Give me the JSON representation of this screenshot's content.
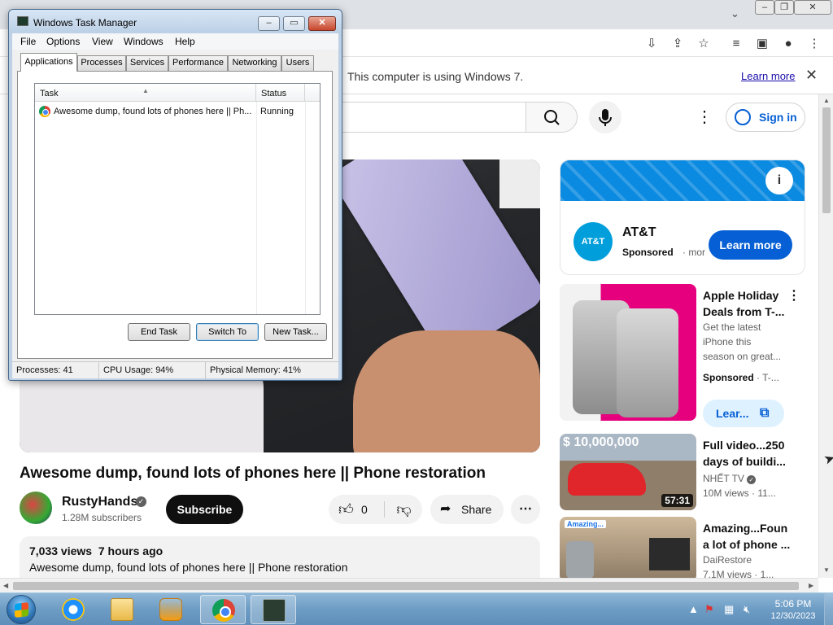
{
  "browser": {
    "infobar_text": "This computer is using Windows 7.",
    "infobar_link": "Learn more"
  },
  "youtube": {
    "signin_label": "Sign in",
    "video": {
      "title": "Awesome dump, found lots of phones here || Phone restoration",
      "channel": "RustyHands",
      "subscribers": "1.28M subscribers",
      "subscribe_label": "Subscribe",
      "like_count": "0",
      "share_label": "Share",
      "views": "7,033 views",
      "uploaded": "7 hours ago",
      "description": "Awesome dump, found lots of phones here || Phone restoration"
    },
    "ad": {
      "logo_text": "AT&T",
      "advertiser": "AT&T",
      "sponsored": "Sponsored",
      "more": "· mor",
      "cta": "Learn more"
    },
    "recommendations": [
      {
        "title_line1": "Apple Holiday",
        "title_line2": "Deals from T-...",
        "description": "Get the latest iPhone this season on great...",
        "sponsored": "Sponsored",
        "sponsor_suffix": "· T-...",
        "cta": "Lear..."
      },
      {
        "thumb_overlay": "$ 10,000,000",
        "duration": "57:31",
        "title_line1": "Full video...250",
        "title_line2": "days of buildi...",
        "channel": "NHẾT TV",
        "meta": "10M views · 11..."
      },
      {
        "thumb_overlay": "Amazing...",
        "title_line1": "Amazing...Foun",
        "title_line2": "a lot of phone ...",
        "channel": "DaiRestore",
        "meta": "7.1M views · 1..."
      }
    ]
  },
  "taskmgr": {
    "title": "Windows Task Manager",
    "menu": [
      "File",
      "Options",
      "View",
      "Windows",
      "Help"
    ],
    "tabs": [
      "Applications",
      "Processes",
      "Services",
      "Performance",
      "Networking",
      "Users"
    ],
    "columns": [
      "Task",
      "Status"
    ],
    "rows": [
      {
        "task": "Awesome dump, found lots of phones here || Ph...",
        "status": "Running"
      }
    ],
    "buttons": [
      "End Task",
      "Switch To",
      "New Task..."
    ],
    "status": {
      "processes": "Processes: 41",
      "cpu": "CPU Usage: 94%",
      "memory": "Physical Memory: 41%"
    }
  },
  "taskbar": {
    "time": "5:06 PM",
    "date": "12/30/2023"
  }
}
